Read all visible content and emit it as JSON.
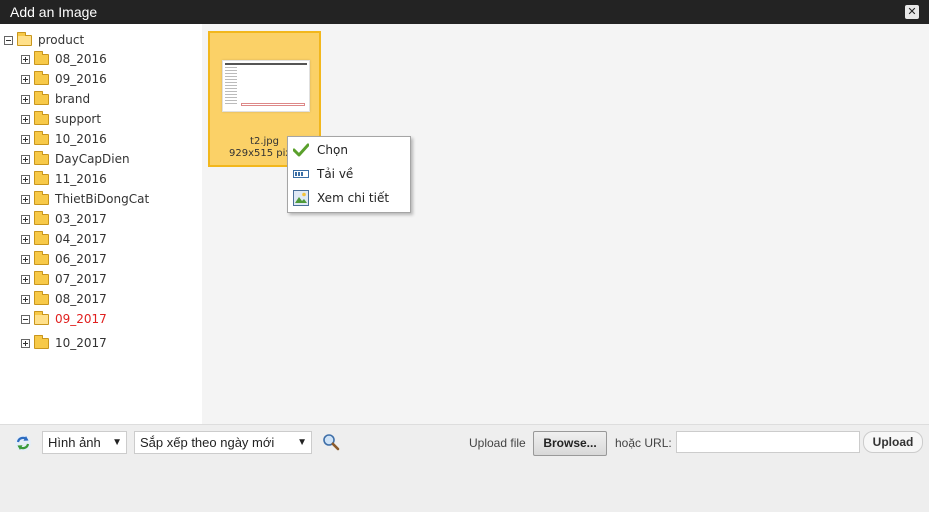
{
  "window": {
    "title": "Add an Image",
    "close_icon": "close-icon",
    "close_glyph": "✕"
  },
  "tree": {
    "root": {
      "label": "product"
    },
    "items": [
      {
        "label": "08_2016",
        "active": false
      },
      {
        "label": "09_2016",
        "active": false
      },
      {
        "label": "brand",
        "active": false
      },
      {
        "label": "support",
        "active": false
      },
      {
        "label": "10_2016",
        "active": false
      },
      {
        "label": "DayCapDien",
        "active": false
      },
      {
        "label": "11_2016",
        "active": false
      },
      {
        "label": "ThietBiDongCat",
        "active": false
      },
      {
        "label": "03_2017",
        "active": false
      },
      {
        "label": "04_2017",
        "active": false
      },
      {
        "label": "06_2017",
        "active": false
      },
      {
        "label": "07_2017",
        "active": false
      },
      {
        "label": "08_2017",
        "active": false
      },
      {
        "label": "09_2017",
        "active": true
      },
      {
        "label": "10_2017",
        "active": false
      }
    ],
    "active_color": "#e0201f"
  },
  "files": [
    {
      "name": "t2.jpg",
      "size": "929x515 pixel"
    }
  ],
  "context_menu": {
    "items": [
      {
        "label": "Chọn",
        "icon": "check-icon"
      },
      {
        "label": "Tải về",
        "icon": "download-icon"
      },
      {
        "label": "Xem chi tiết",
        "icon": "image-preview-icon"
      }
    ]
  },
  "toolbar": {
    "filter_value": "Hình ảnh",
    "sort_value": "Sắp xếp theo ngày mới",
    "upload_file_label": "Upload file",
    "browse_label": "Browse...",
    "or_url_label": "hoặc URL:",
    "url_value": "",
    "upload_label": "Upload",
    "arrow_glyph": "▼"
  },
  "colors": {
    "titlebar": "#232323",
    "selected_thumb": "#fbd167",
    "selected_border": "#f2b71c"
  }
}
